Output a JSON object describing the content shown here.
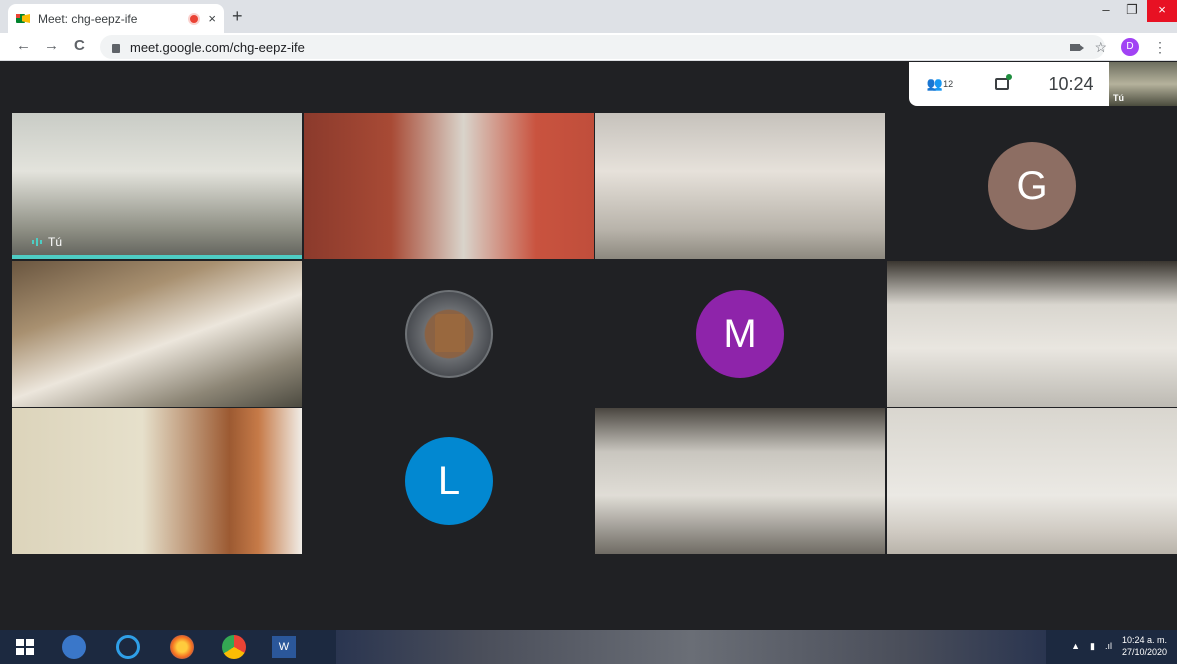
{
  "browser": {
    "tab_title": "Meet: chg-eepz-ife",
    "tab_close": "×",
    "new_tab": "+",
    "back": "←",
    "forward": "→",
    "reload": "C",
    "url": "meet.google.com/chg-eepz-ife",
    "bookmark_star": "☆",
    "profile_initial": "D",
    "menu": "⋮",
    "minimize": "–",
    "restore": "❐",
    "close": "×"
  },
  "meet": {
    "participant_count": "12",
    "clock": "10:24",
    "self_label": "Tú",
    "tiles": [
      {
        "name": "Tú",
        "type": "video"
      },
      {
        "name": "",
        "type": "video"
      },
      {
        "name": "",
        "type": "video"
      },
      {
        "name": "",
        "type": "avatar",
        "initial": "G",
        "color": "#8d6e63"
      },
      {
        "name": "",
        "type": "video"
      },
      {
        "name": "",
        "type": "logo"
      },
      {
        "name": "",
        "type": "avatar",
        "initial": "M",
        "color": "#8e24aa"
      },
      {
        "name": "",
        "type": "video"
      },
      {
        "name": "",
        "type": "video"
      },
      {
        "name": "",
        "type": "avatar",
        "initial": "L",
        "color": "#0288d1"
      },
      {
        "name": "",
        "type": "video"
      },
      {
        "name": "",
        "type": "video"
      }
    ]
  },
  "taskbar": {
    "word_label": "W",
    "tray_time": "10:24 a. m.",
    "tray_date": "27/10/2020",
    "tray_arrow": "▲"
  }
}
